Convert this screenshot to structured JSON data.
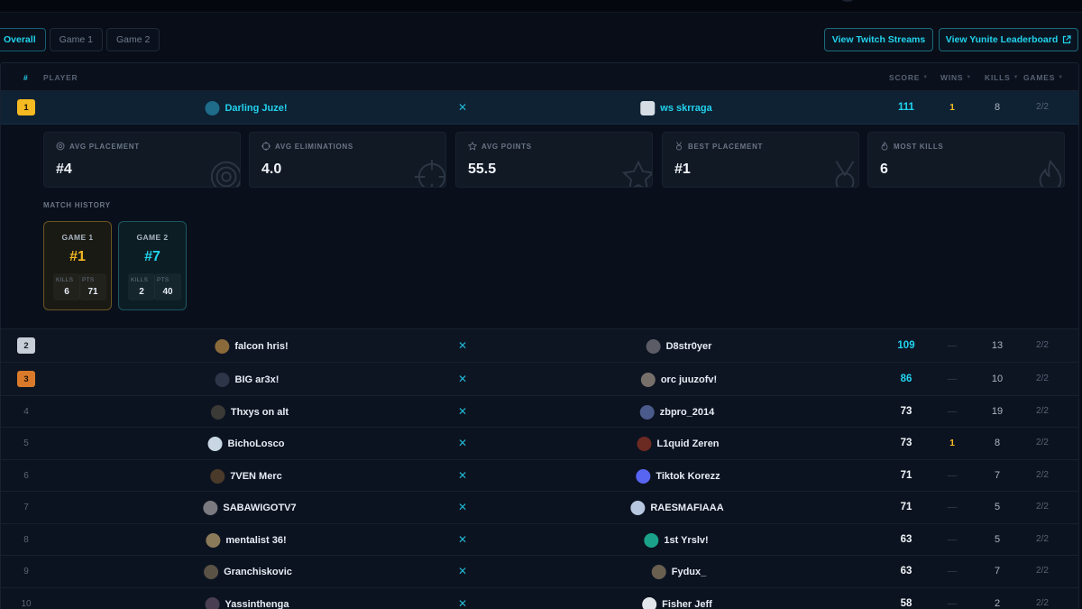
{
  "tabs": [
    {
      "label": "Overall",
      "active": true
    },
    {
      "label": "Game 1",
      "active": false
    },
    {
      "label": "Game 2",
      "active": false
    }
  ],
  "buttons": {
    "twitch": "View Twitch Streams",
    "yunite": "View Yunite Leaderboard"
  },
  "columns": {
    "rank": "#",
    "player": "PLAYER",
    "score": "SCORE",
    "wins": "WINS",
    "kills": "KILLS",
    "games": "GAMES"
  },
  "separator": "✕",
  "rows": [
    {
      "rank": "1",
      "p1": "Darling Juze!",
      "p2": "ws skrraga",
      "score": "111",
      "wins": "1",
      "kills": "8",
      "games": "2/2"
    },
    {
      "rank": "2",
      "p1": "falcon hris!",
      "p2": "D8str0yer",
      "score": "109",
      "wins": "—",
      "kills": "13",
      "games": "2/2"
    },
    {
      "rank": "3",
      "p1": "BIG ar3x!",
      "p2": "orc juuzofv!",
      "score": "86",
      "wins": "—",
      "kills": "10",
      "games": "2/2"
    },
    {
      "rank": "4",
      "p1": "Thxys on alt",
      "p2": "zbpro_2014",
      "score": "73",
      "wins": "—",
      "kills": "19",
      "games": "2/2"
    },
    {
      "rank": "5",
      "p1": "BichoLosco",
      "p2": "L1quid Zeren",
      "score": "73",
      "wins": "1",
      "kills": "8",
      "games": "2/2"
    },
    {
      "rank": "6",
      "p1": "7VEN Merc",
      "p2": "Tiktok Korezz",
      "score": "71",
      "wins": "—",
      "kills": "7",
      "games": "2/2"
    },
    {
      "rank": "7",
      "p1": "SABAWIGOTV7",
      "p2": "RAESMAFIAAA",
      "score": "71",
      "wins": "—",
      "kills": "5",
      "games": "2/2"
    },
    {
      "rank": "8",
      "p1": "mentalist 36!",
      "p2": "1st Yrslv!",
      "score": "63",
      "wins": "—",
      "kills": "5",
      "games": "2/2"
    },
    {
      "rank": "9",
      "p1": "Granchiskovic",
      "p2": "Fydux_",
      "score": "63",
      "wins": "—",
      "kills": "7",
      "games": "2/2"
    },
    {
      "rank": "10",
      "p1": "Yassinthenga",
      "p2": "Fisher Jeff",
      "score": "58",
      "wins": "—",
      "kills": "2",
      "games": "2/2"
    }
  ],
  "stats": [
    {
      "label": "AVG PLACEMENT",
      "value": "#4",
      "icon": "target-icon"
    },
    {
      "label": "AVG ELIMINATIONS",
      "value": "4.0",
      "icon": "crosshair-icon"
    },
    {
      "label": "AVG POINTS",
      "value": "55.5",
      "icon": "star-icon"
    },
    {
      "label": "BEST PLACEMENT",
      "value": "#1",
      "icon": "medal-icon"
    },
    {
      "label": "MOST KILLS",
      "value": "6",
      "icon": "flame-icon"
    }
  ],
  "match_history": {
    "label": "MATCH HISTORY",
    "games": [
      {
        "title": "GAME 1",
        "placement": "#1",
        "kills_label": "KILLS",
        "kills": "6",
        "pts_label": "PTS",
        "pts": "71"
      },
      {
        "title": "GAME 2",
        "placement": "#7",
        "kills_label": "KILLS",
        "kills": "2",
        "pts_label": "PTS",
        "pts": "40"
      }
    ]
  },
  "colors": {
    "accent": "#22d3ee",
    "gold": "#f5b921",
    "silver": "#c7ced8",
    "bronze": "#d97a2b"
  }
}
